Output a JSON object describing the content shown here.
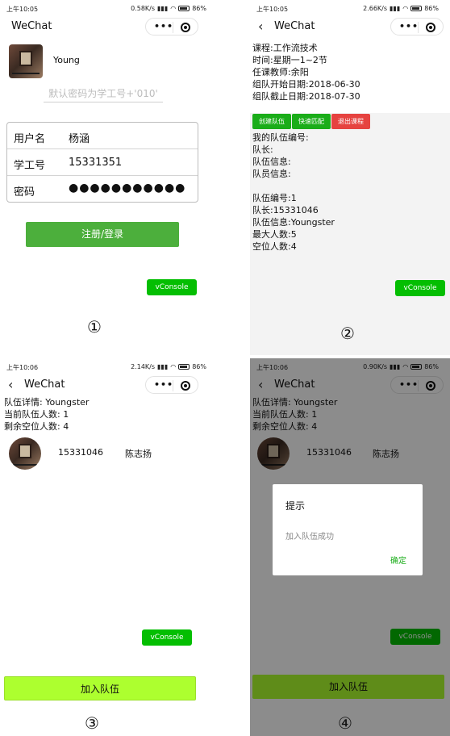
{
  "panels": [
    {
      "status": {
        "time": "上午10:05",
        "net": "0.58K/s",
        "battery": "86%"
      },
      "nav": {
        "title": "WeChat"
      },
      "user": {
        "name": "Young"
      },
      "password_hint": "默认密码为学工号+'010'",
      "form": [
        {
          "label": "用户名",
          "value": "杨涵"
        },
        {
          "label": "学工号",
          "value": "15331351"
        },
        {
          "label": "密码",
          "value": "●●●●●●●●●●●"
        }
      ],
      "submit_label": "注册/登录",
      "vconsole": "vConsole",
      "marker": "①"
    },
    {
      "status": {
        "time": "上午10:05",
        "net": "2.66K/s",
        "battery": "86%"
      },
      "nav": {
        "title": "WeChat"
      },
      "course": [
        "课程:工作流技术",
        "时间:星期一1~2节",
        "任课教师:余阳",
        "组队开始日期:2018-06-30",
        "组队截止日期:2018-07-30"
      ],
      "buttons": {
        "create": "创建队伍",
        "match": "快速匹配",
        "quit": "退出课程"
      },
      "team": [
        "我的队伍编号:",
        "队长:",
        "队伍信息:",
        "队员信息:",
        "",
        "队伍编号:1",
        "队长:15331046",
        "队伍信息:Youngster",
        "最大人数:5",
        "空位人数:4"
      ],
      "vconsole": "vConsole",
      "marker": "②"
    },
    {
      "status": {
        "time": "上午10:06",
        "net": "2.14K/s",
        "battery": "86%"
      },
      "nav": {
        "title": "WeChat"
      },
      "detail": [
        "队伍详情: Youngster",
        "当前队伍人数: 1",
        "剩余空位人数: 4"
      ],
      "member": {
        "id": "15331046",
        "name": "陈志扬"
      },
      "vconsole": "vConsole",
      "join_label": "加入队伍",
      "marker": "③"
    },
    {
      "status": {
        "time": "上午10:06",
        "net": "0.90K/s",
        "battery": "86%"
      },
      "nav": {
        "title": "WeChat"
      },
      "detail": [
        "队伍详情: Youngster",
        "当前队伍人数: 1",
        "剩余空位人数: 4"
      ],
      "member": {
        "id": "15331046",
        "name": "陈志扬"
      },
      "modal": {
        "title": "提示",
        "content": "加入队伍成功",
        "ok": "确定"
      },
      "vconsole": "vConsole",
      "join_label": "加入队伍",
      "marker": "④"
    }
  ]
}
